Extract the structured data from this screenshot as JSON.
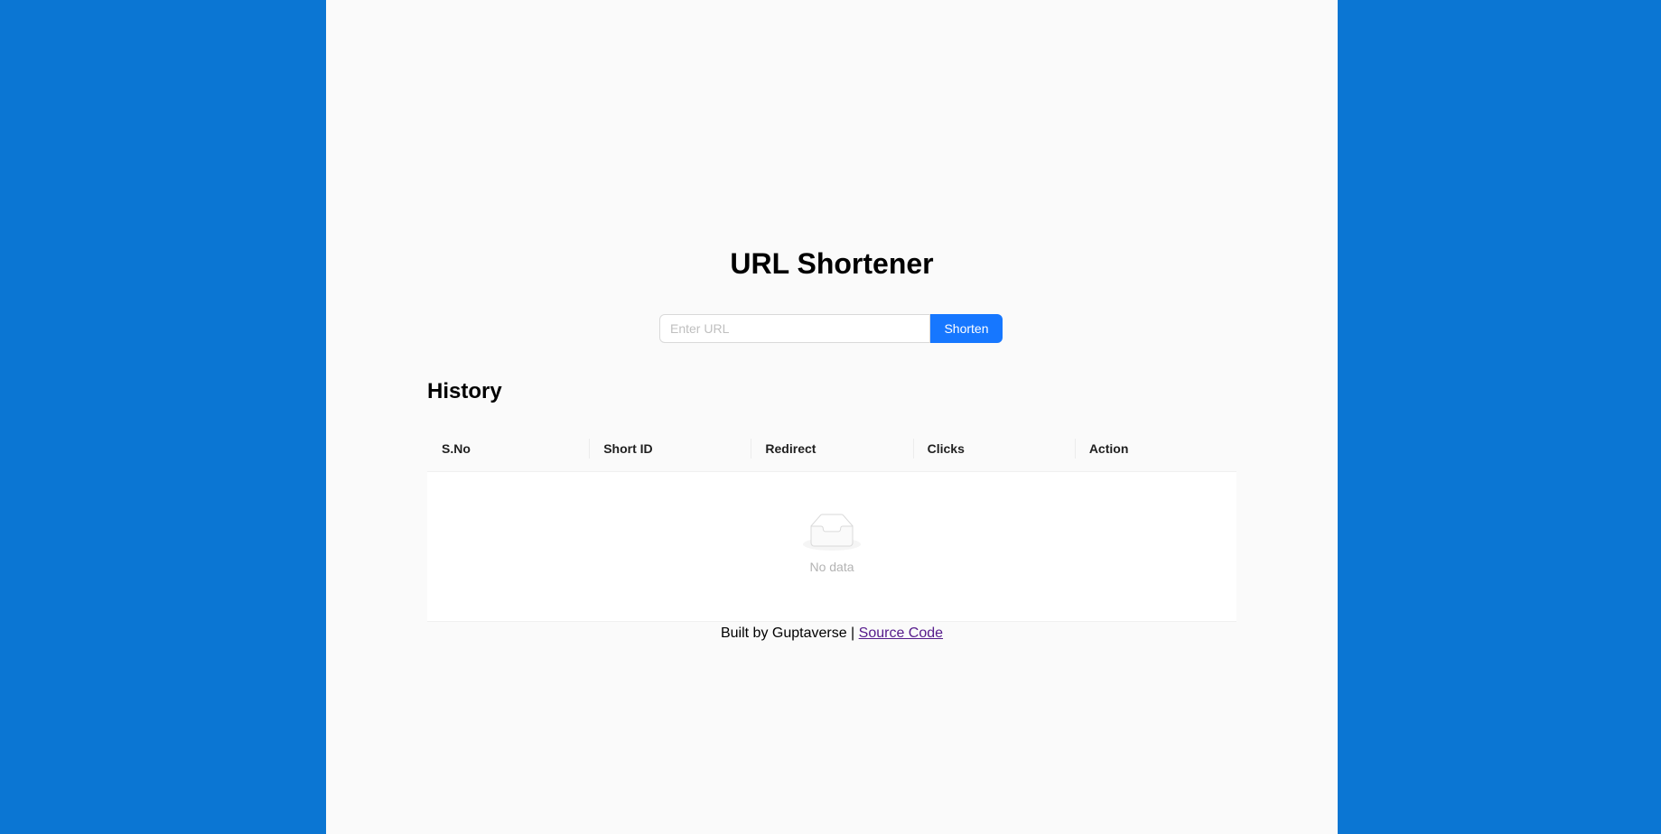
{
  "header": {
    "title": "URL Shortener"
  },
  "shorten_form": {
    "input_value": "",
    "input_placeholder": "Enter URL",
    "button_label": "Shorten"
  },
  "history": {
    "heading": "History",
    "columns": [
      "S.No",
      "Short ID",
      "Redirect",
      "Clicks",
      "Action"
    ],
    "rows": [],
    "empty_text": "No data"
  },
  "footer": {
    "text": "Built by Guptaverse | ",
    "link_label": "Source Code"
  },
  "colors": {
    "page_background": "#0b76d3",
    "panel_background": "#fafafa",
    "primary_button": "#1677ff",
    "visited_link": "#551a8b"
  },
  "icons": {
    "empty_state": "empty-inbox-icon"
  }
}
